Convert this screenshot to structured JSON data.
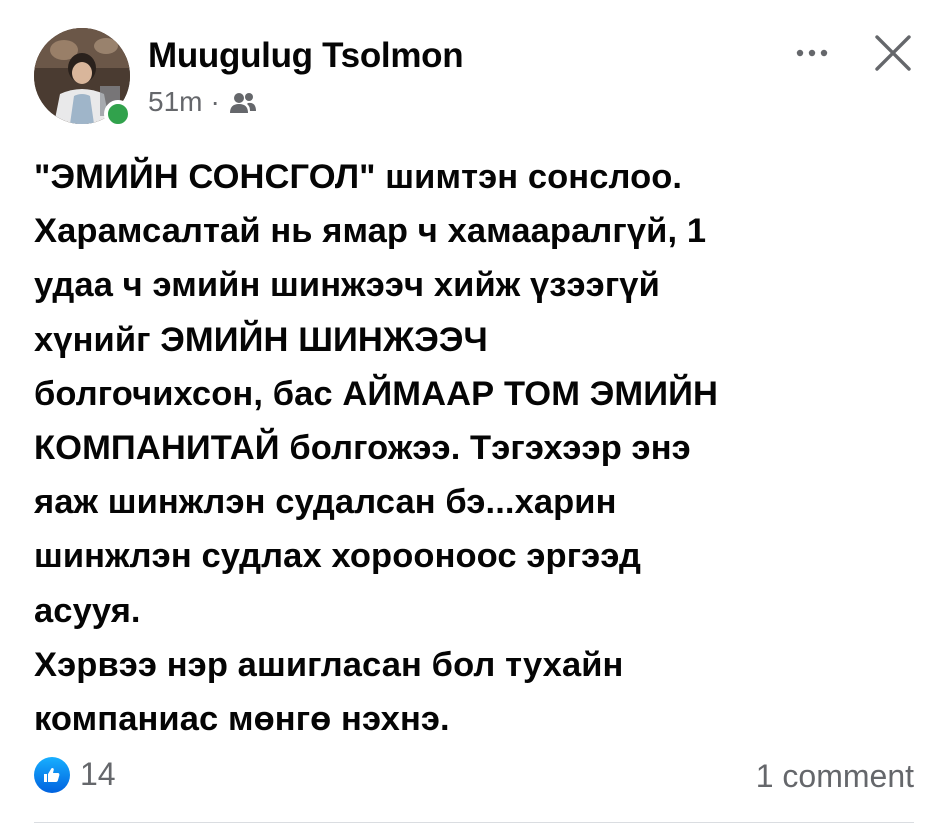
{
  "post": {
    "author": {
      "name": "Muugulug Tsolmon",
      "online": true,
      "online_color": "#31a24c"
    },
    "timestamp": "51m",
    "separator": "·",
    "audience_icon": "friends-icon",
    "header_actions": {
      "more_icon": "more-horizontal-icon",
      "close_icon": "close-icon"
    },
    "text": "\"ЭМИЙН СОНСГОЛ\" шимтэн сонслоо.\nХарамсалтай нь ямар ч хамааралгүй, 1\nудаа ч эмийн шинжээч хийж үзээгүй\nхүнийг ЭМИЙН ШИНЖЭЭЧ\nболгочихсон, бас АЙМААР ТОМ ЭМИЙН\nКОМПАНИТАЙ болгожээ. Тэгэхээр энэ\nяаж шинжлэн судалсан бэ...харин\nшинжлэн судлах хорооноос эргээд\nасууя.\nХэрвээ нэр ашигласан бол тухайн\nкомпаниас мөнгө нэхнэ.",
    "reactions": {
      "icon": "like-icon",
      "count": "14",
      "color": "#0866ff"
    },
    "comments_label": "1 comment"
  }
}
